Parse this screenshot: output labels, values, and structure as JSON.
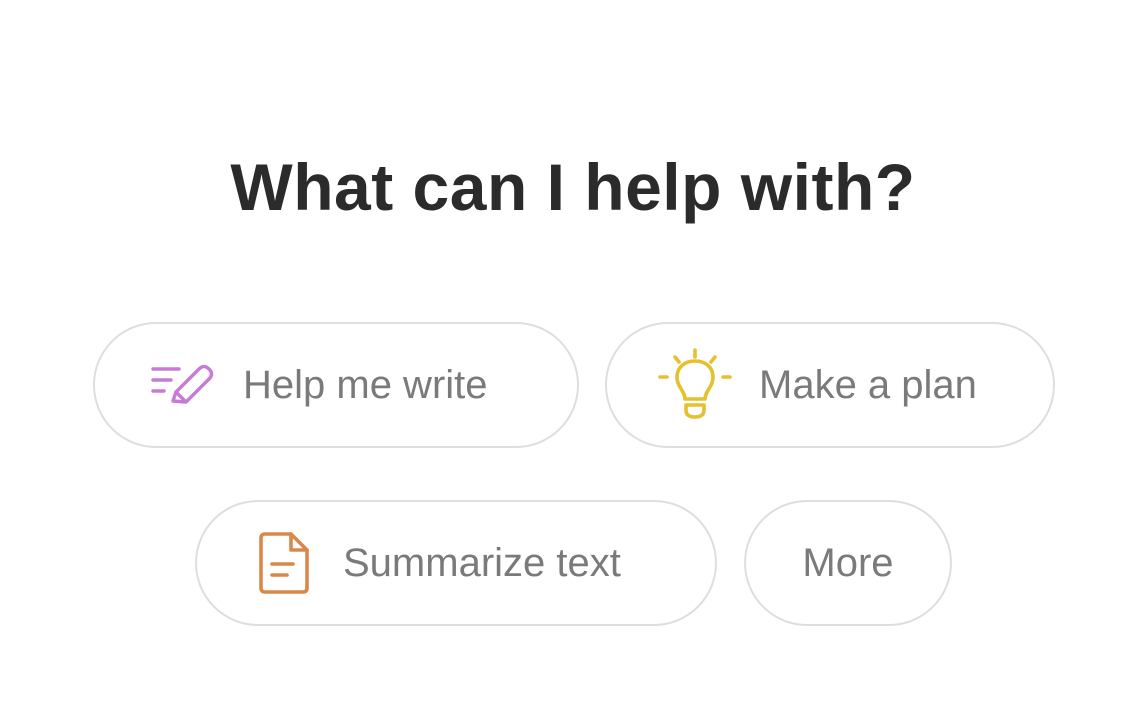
{
  "heading": "What can I help with?",
  "suggestions": [
    {
      "label": "Help me write",
      "icon": "pen-lines-icon",
      "color": "#c77ad6"
    },
    {
      "label": "Make a plan",
      "icon": "lightbulb-icon",
      "color": "#e6c02e"
    },
    {
      "label": "Summarize text",
      "icon": "document-icon",
      "color": "#d9884a"
    },
    {
      "label": "More"
    }
  ]
}
